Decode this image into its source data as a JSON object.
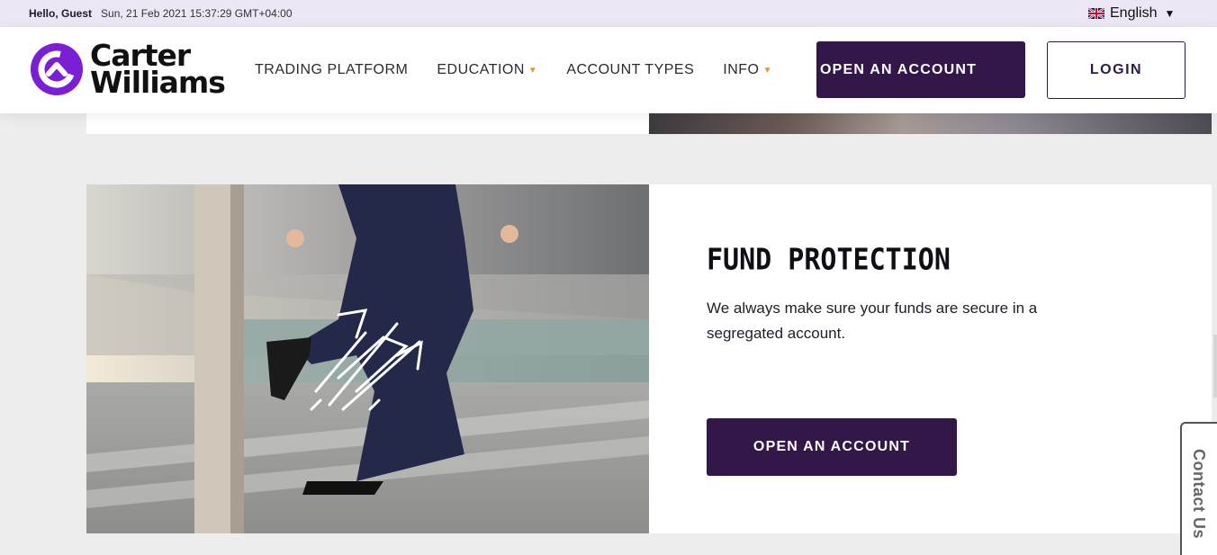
{
  "topbar": {
    "greeting": "Hello, Guest",
    "datetime": "Sun, 21 Feb 2021 15:37:29 GMT+04:00",
    "language": "English"
  },
  "header": {
    "logo_line1": "Carter",
    "logo_line2": "Williams",
    "nav": [
      {
        "label": "TRADING PLATFORM",
        "dropdown": false
      },
      {
        "label": "EDUCATION",
        "dropdown": true
      },
      {
        "label": "ACCOUNT TYPES",
        "dropdown": false
      },
      {
        "label": "INFO",
        "dropdown": true
      }
    ],
    "open_account_label": "OPEN AN ACCOUNT",
    "login_label": "LOGIN"
  },
  "card": {
    "title": "FUND PROTECTION",
    "text": "We always make sure your funds are secure in a segregated account.",
    "button_label": "OPEN AN ACCOUNT"
  },
  "contact_tab": {
    "label": "Contact Us"
  },
  "colors": {
    "brand_purple": "#321748",
    "logo_purple": "#7a1fd6",
    "accent_orange": "#e09a26",
    "topbar_bg": "#ede6f5"
  }
}
